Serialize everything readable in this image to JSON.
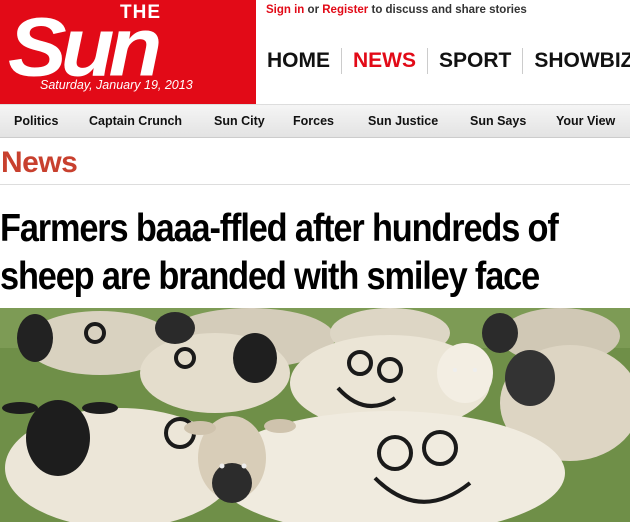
{
  "logo": {
    "the": "THE",
    "sun": "Sun",
    "date": "Saturday, January 19, 2013"
  },
  "account": {
    "signin": "Sign in",
    "or": "or",
    "register": "Register",
    "suffix": "to discuss and share stories"
  },
  "main_nav": [
    {
      "label": "HOME"
    },
    {
      "label": "NEWS",
      "active": true
    },
    {
      "label": "SPORT"
    },
    {
      "label": "SHOWBIZ"
    }
  ],
  "sub_nav": [
    {
      "label": "Politics"
    },
    {
      "label": "Captain Crunch"
    },
    {
      "label": "Sun City"
    },
    {
      "label": "Forces"
    },
    {
      "label": "Sun Justice"
    },
    {
      "label": "Sun Says"
    },
    {
      "label": "Your View"
    }
  ],
  "section": {
    "title": "News"
  },
  "article": {
    "headline_line1": "Farmers baaa-ffled after hundreds of",
    "headline_line2": "sheep are branded with smiley face"
  },
  "colors": {
    "brand_red": "#e20a17",
    "section_red": "#c8402e"
  }
}
